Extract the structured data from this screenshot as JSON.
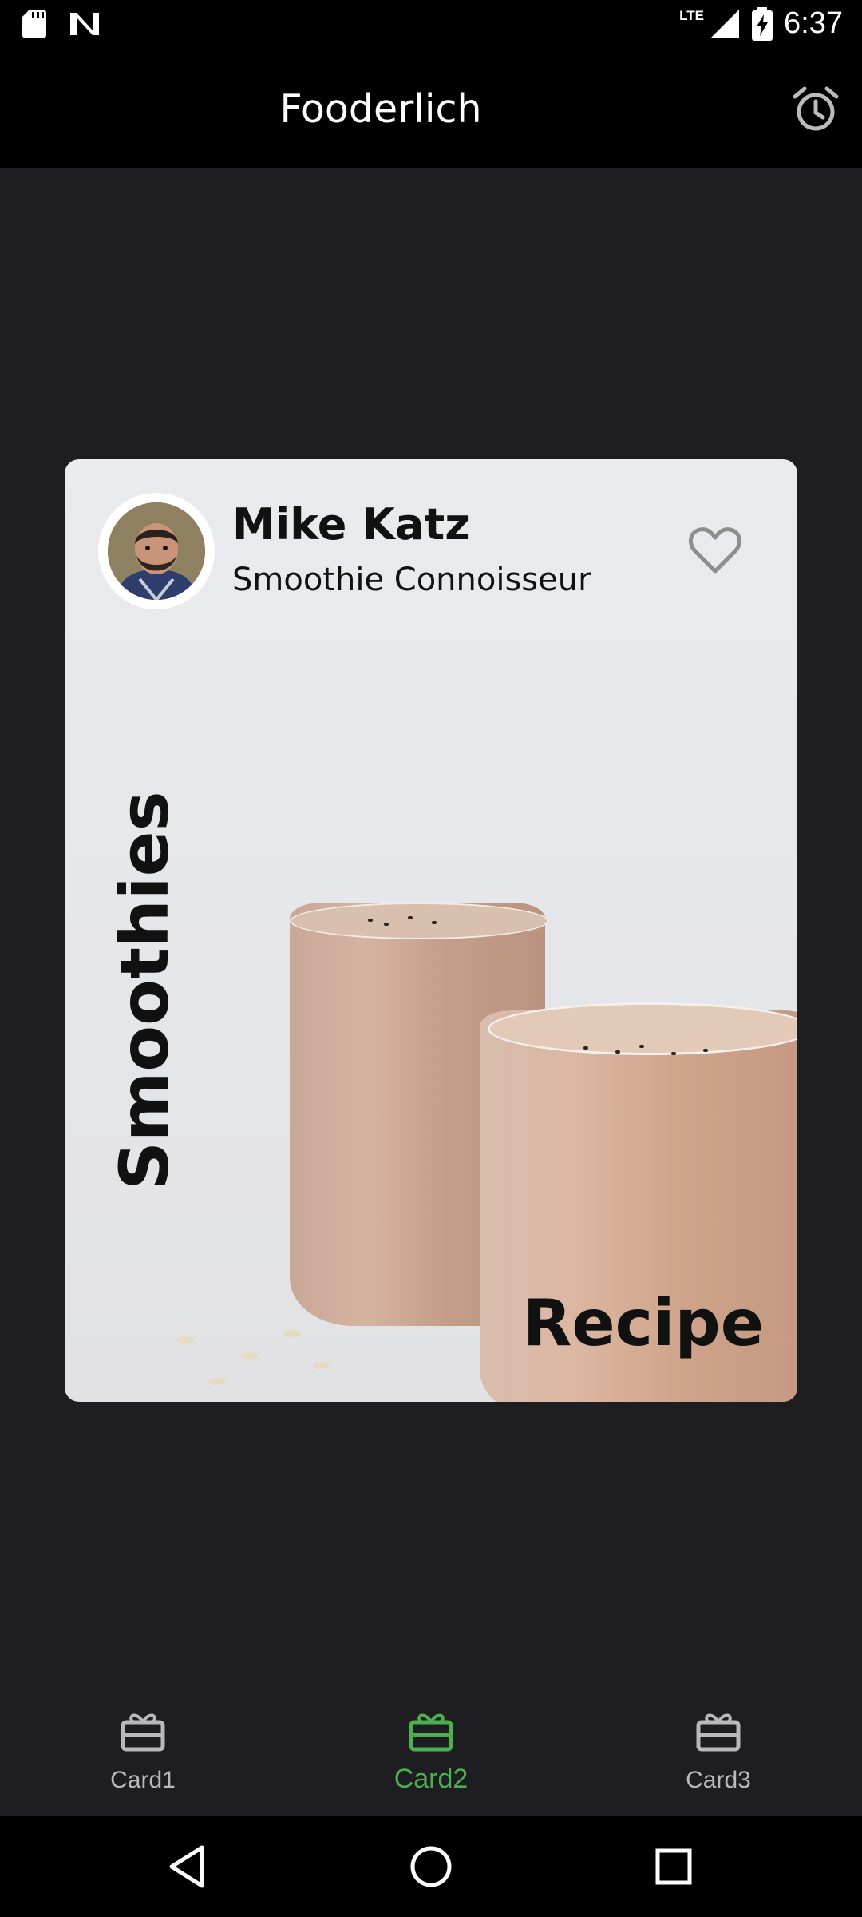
{
  "status_bar": {
    "network_label": "LTE",
    "time": "6:37",
    "icons": [
      "sd-card-icon",
      "n-logo-icon",
      "signal-icon",
      "battery-charging-icon"
    ]
  },
  "app_bar": {
    "title": "Fooderlich",
    "action_icon": "alarm-clock-icon"
  },
  "card": {
    "author_name": "Mike Katz",
    "author_title": "Smoothie Connoisseur",
    "favorite_icon": "heart-outline-icon",
    "vertical_label": "Smoothies",
    "corner_label": "Recipe",
    "background_image": "smoothie-glasses-photo"
  },
  "bottom_nav": {
    "items": [
      {
        "label": "Card1",
        "icon": "card-giftcard-icon",
        "active": false
      },
      {
        "label": "Card2",
        "icon": "card-giftcard-icon",
        "active": true
      },
      {
        "label": "Card3",
        "icon": "card-giftcard-icon",
        "active": false
      }
    ],
    "active_color": "#4caf50",
    "inactive_color": "#b9b8bd"
  },
  "system_nav": {
    "icons": [
      "back-triangle-icon",
      "home-circle-icon",
      "recents-square-icon"
    ]
  }
}
